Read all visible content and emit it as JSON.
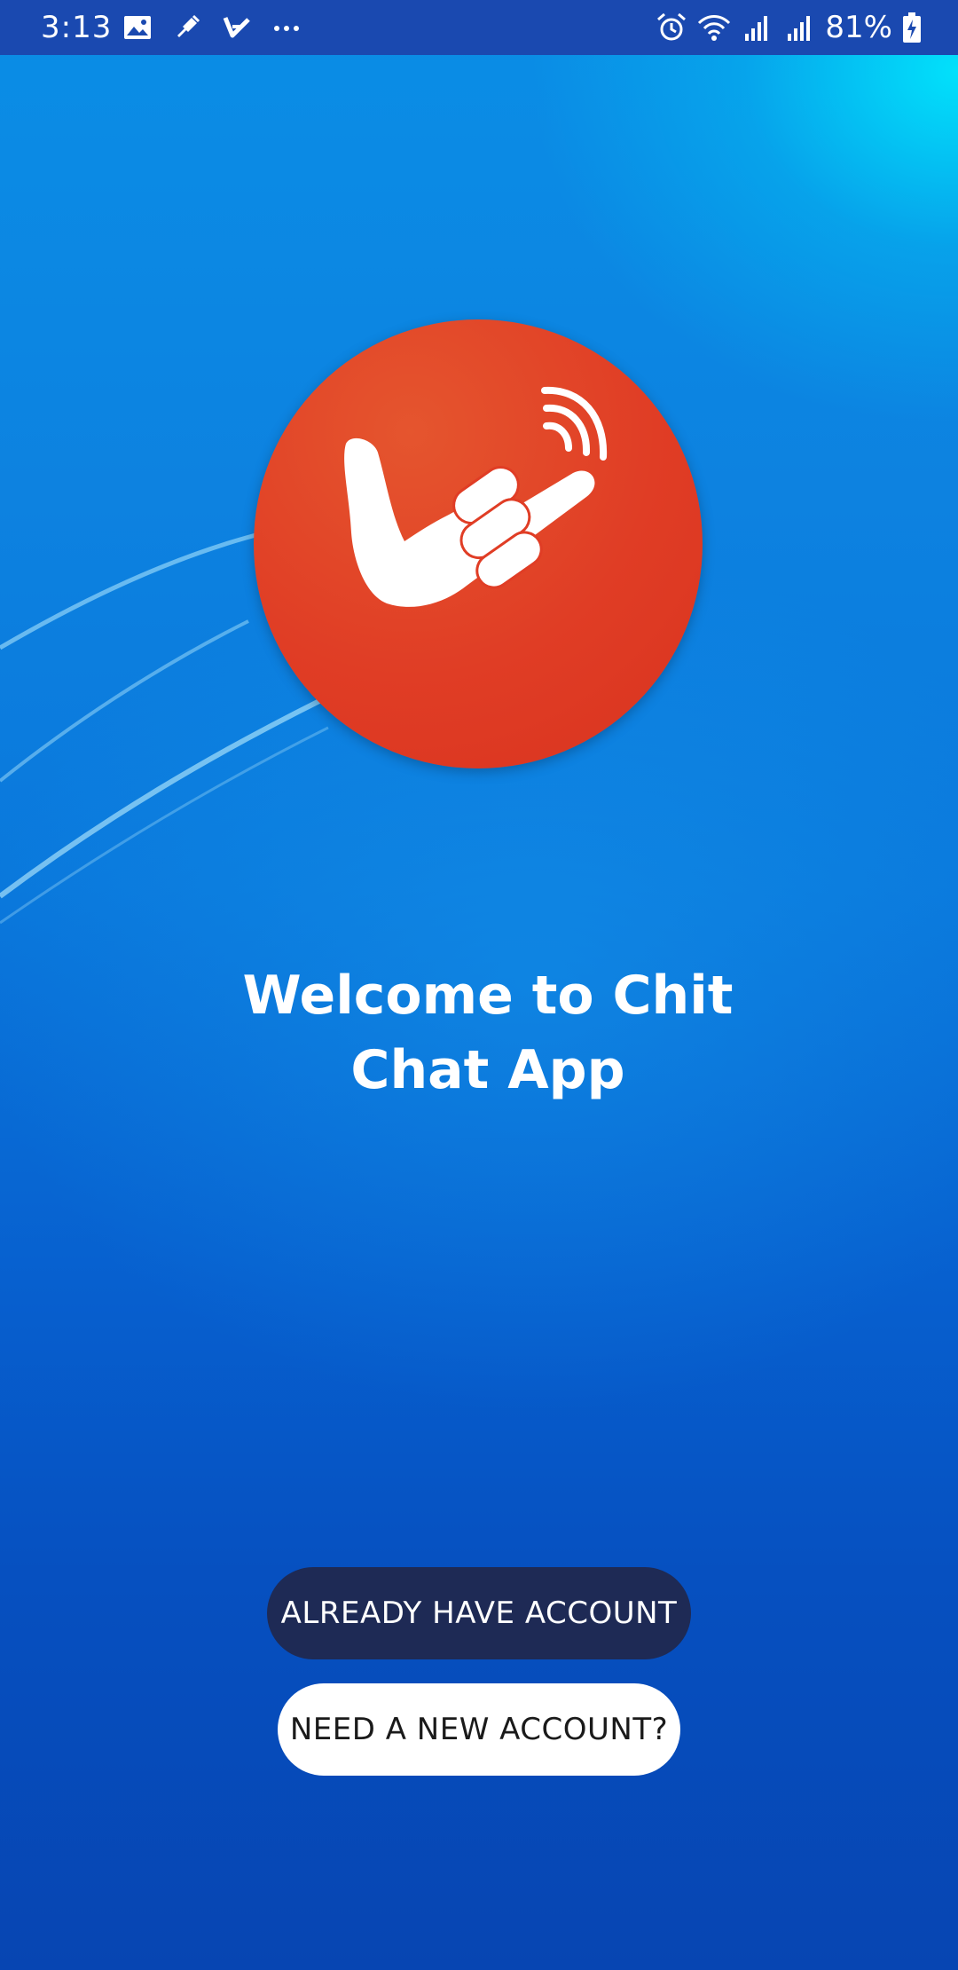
{
  "status_bar": {
    "time": "3:13",
    "battery": "81%",
    "icons_left": [
      "gallery-icon",
      "usb-icon",
      "check-icon",
      "more-dots-icon"
    ],
    "icons_right": [
      "alarm-icon",
      "wifi-icon",
      "signal-icon",
      "signal-icon",
      "battery-icon"
    ]
  },
  "logo": {
    "icon": "hand-signal-logo-icon",
    "color": "#e03d25"
  },
  "welcome": {
    "title": "Welcome to Chit Chat App"
  },
  "buttons": {
    "login_label": "ALREADY HAVE ACCOUNT",
    "register_label": "NEED A NEW ACCOUNT?"
  },
  "colors": {
    "status_bar": "#1a49b0",
    "login_button": "#1e2a55",
    "register_button": "#ffffff",
    "background_top": "#0a8ee6",
    "background_bottom": "#0745b2"
  }
}
